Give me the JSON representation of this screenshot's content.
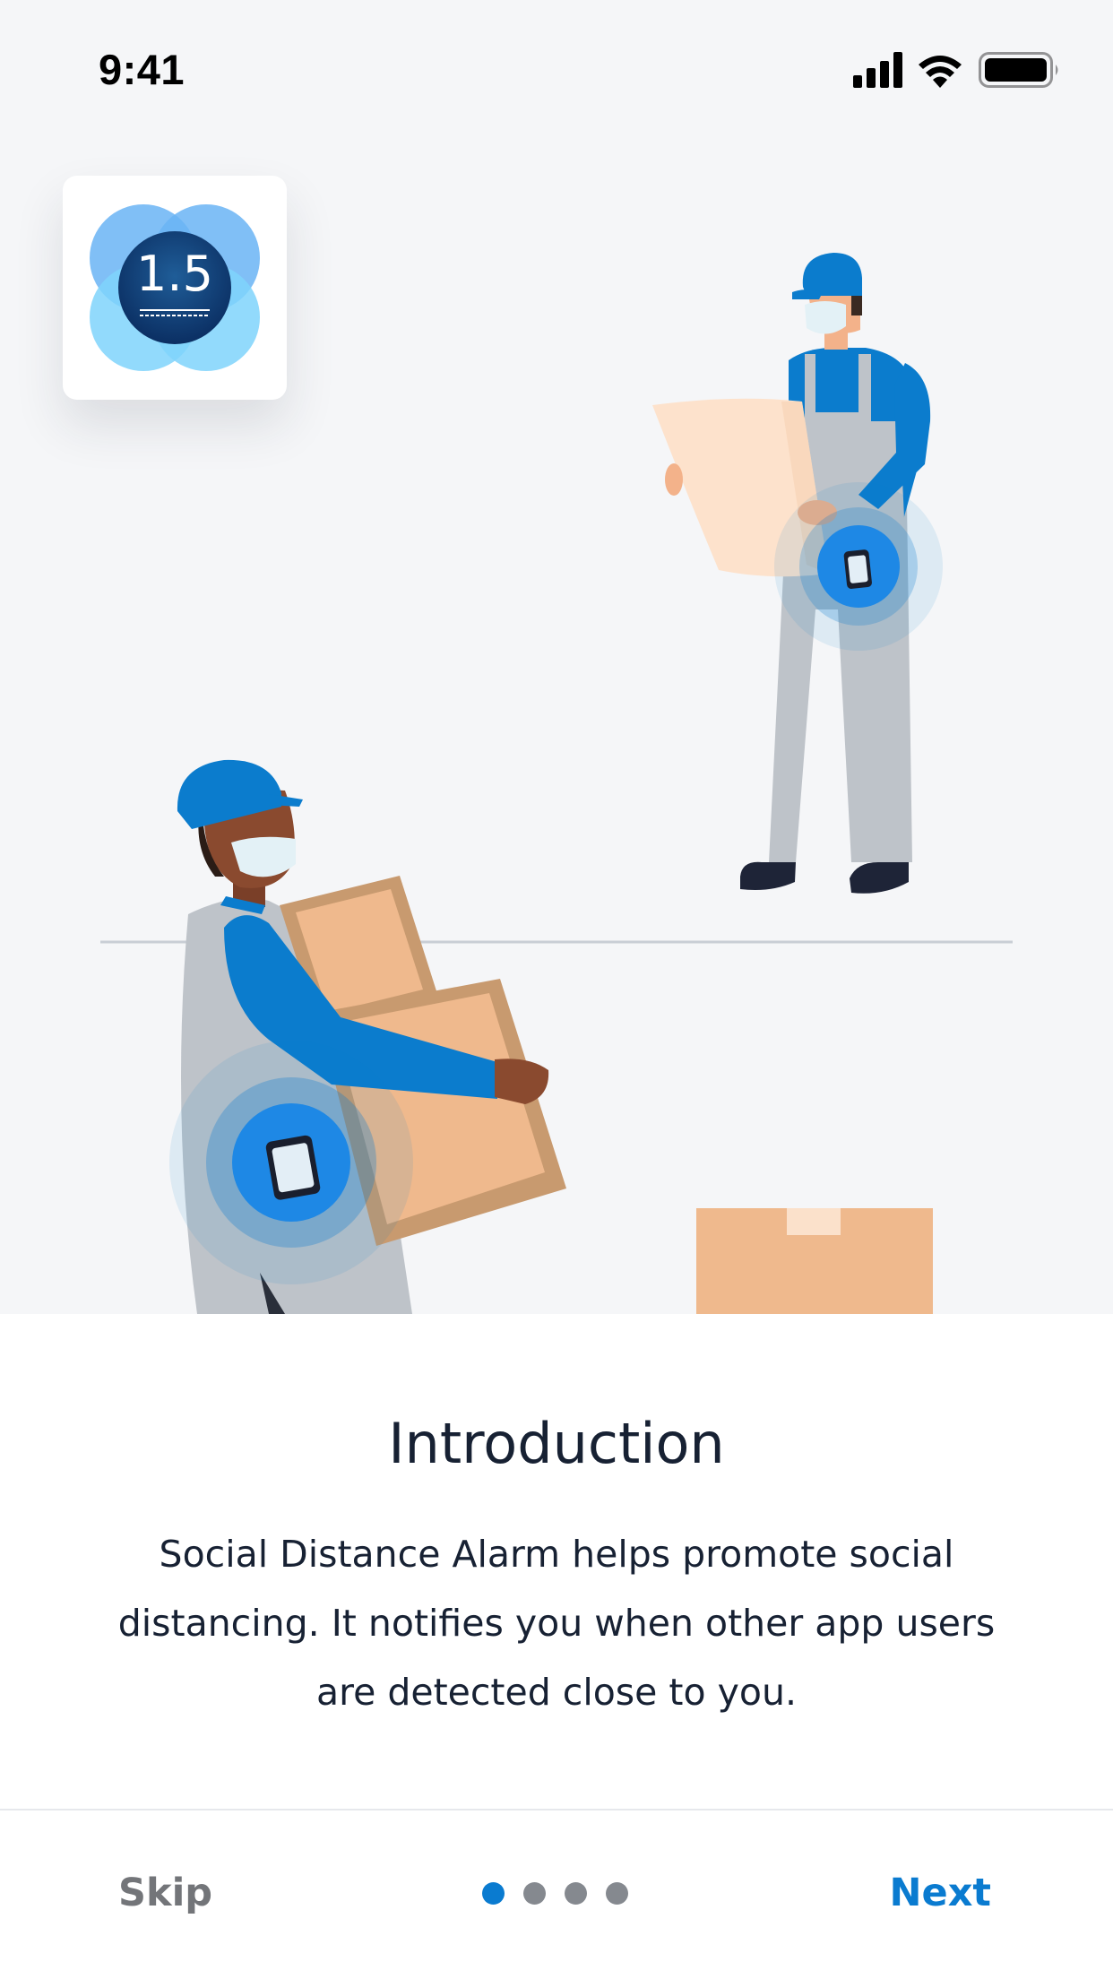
{
  "status_bar": {
    "time": "9:41",
    "icons": [
      "cellular-signal-icon",
      "wifi-icon",
      "battery-icon"
    ]
  },
  "app_logo": {
    "text": "1.5",
    "icon": "social-distance-logo-icon"
  },
  "onboarding": {
    "title": "Introduction",
    "description": "Social Distance Alarm helps promote social distancing. It notifies you when other app users are detected close to you.",
    "current_page": 1,
    "total_pages": 4
  },
  "footer": {
    "skip_label": "Skip",
    "next_label": "Next"
  },
  "colors": {
    "accent": "#0a7bd0",
    "skip_text": "#737579",
    "dot_inactive": "#85898f",
    "illustration_background": "#f5f6f8",
    "worker_blue": "#0b7ccd",
    "box_tan": "#efb98d"
  }
}
